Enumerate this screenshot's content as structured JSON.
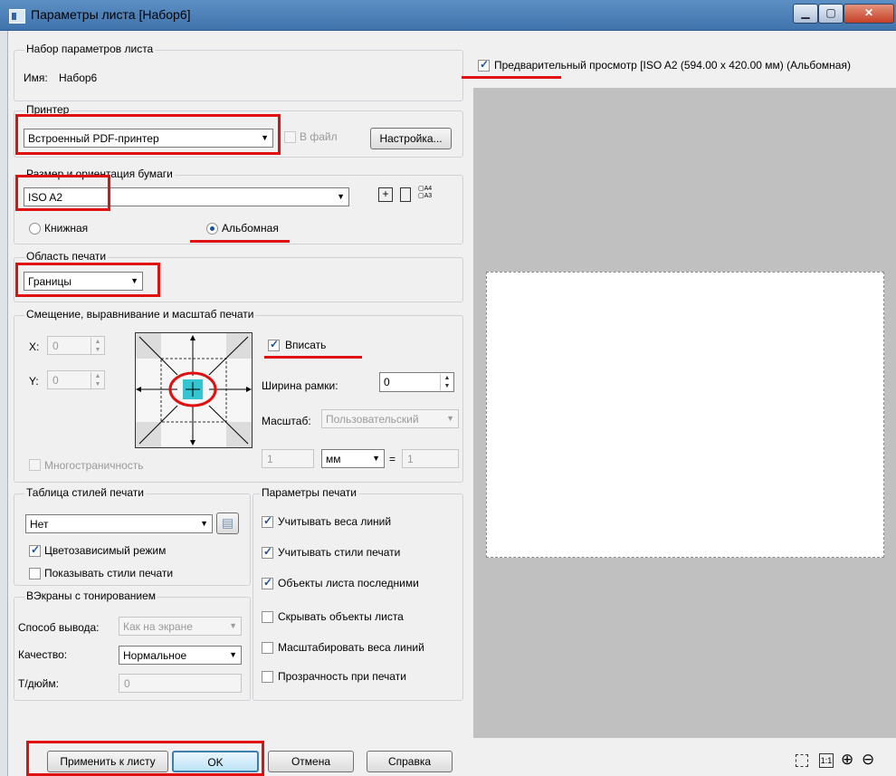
{
  "window": {
    "title": "Параметры листа [Набор6]"
  },
  "sheet_set": {
    "group_label": "Набор параметров листа",
    "name_label": "Имя:",
    "name_value": "Набор6"
  },
  "printer": {
    "group_label": "Принтер",
    "selected": "Встроенный PDF-принтер",
    "to_file_label": "В файл",
    "to_file_checked": false,
    "settings_button": "Настройка..."
  },
  "paper": {
    "group_label": "Размер и ориентация бумаги",
    "size": "ISO A2",
    "portrait_label": "Книжная",
    "landscape_label": "Альбомная",
    "orientation": "landscape"
  },
  "print_area": {
    "group_label": "Область печати",
    "selected": "Границы"
  },
  "offset": {
    "group_label": "Смещение, выравнивание и масштаб печати",
    "x_label": "X:",
    "x_value": "0",
    "y_label": "Y:",
    "y_value": "0",
    "fit_label": "Вписать",
    "fit_checked": true,
    "border_width_label": "Ширина рамки:",
    "border_width_value": "0",
    "scale_label": "Масштаб:",
    "scale_value": "Пользовательский",
    "scale_num": "1",
    "unit": "мм",
    "equals": "=",
    "scale_den": "1",
    "multipage_label": "Многостраничность",
    "multipage_checked": false
  },
  "style_table": {
    "group_label": "Таблица стилей печати",
    "selected": "Нет",
    "color_dependent_label": "Цветозависимый режим",
    "color_dependent_checked": true,
    "show_styles_label": "Показывать стили печати",
    "show_styles_checked": false
  },
  "shaded": {
    "group_label": "ВЭкраны с тонированием",
    "output_label": "Способ вывода:",
    "output_value": "Как на экране",
    "quality_label": "Качество:",
    "quality_value": "Нормальное",
    "dpi_label": "Т/дюйм:",
    "dpi_value": "0"
  },
  "print_params": {
    "group_label": "Параметры печати",
    "items": [
      {
        "label": "Учитывать веса линий",
        "checked": true
      },
      {
        "label": "Учитывать стили печати",
        "checked": true
      },
      {
        "label": "Объекты листа последними",
        "checked": true
      },
      {
        "label": "Скрывать объекты листа",
        "checked": false
      },
      {
        "label": "Масштабировать веса линий",
        "checked": false
      },
      {
        "label": "Прозрачность при печати",
        "checked": false
      }
    ]
  },
  "preview": {
    "label": "Предварительный просмотр [ISO A2 (594.00 x 420.00 мм) (Альбомная)",
    "checked": true
  },
  "buttons": {
    "apply": "Применить к листу",
    "ok": "OK",
    "cancel": "Отмена",
    "help": "Справка"
  },
  "zoom_tools": {
    "fit_icon": "zoom-extents-icon",
    "actual": "1:1",
    "zoom_in": "⊕",
    "zoom_out": "⊖"
  },
  "annotation_color": "#e01010"
}
